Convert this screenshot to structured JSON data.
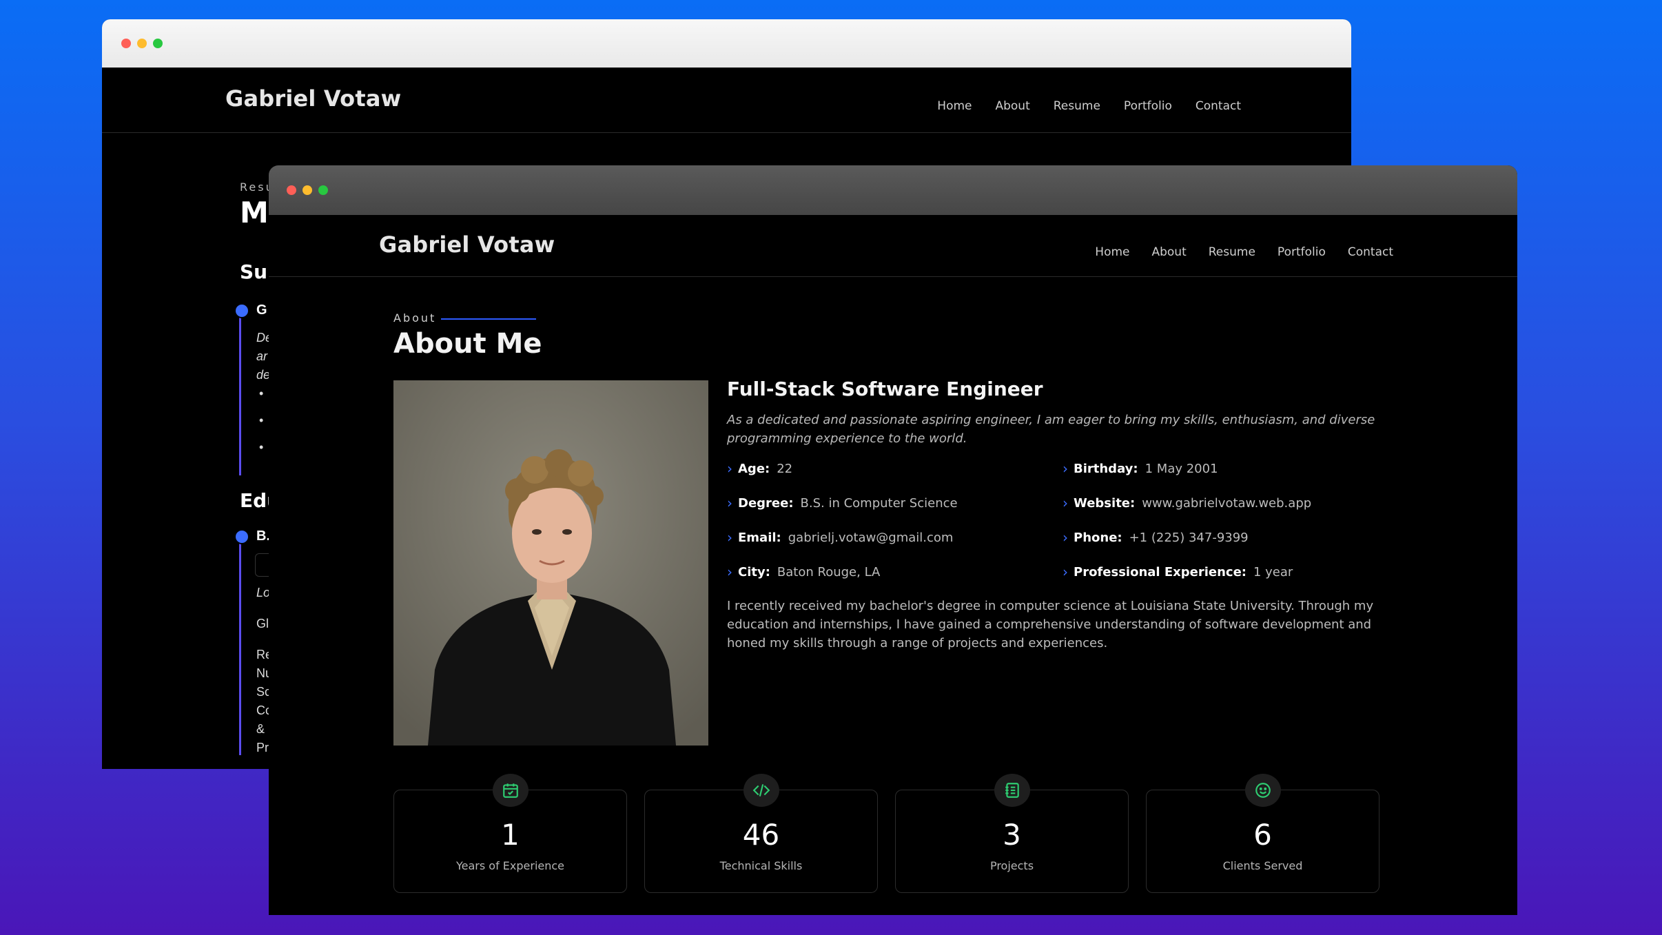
{
  "back_window": {
    "logo": "Gabriel Votaw",
    "nav": [
      "Home",
      "About",
      "Resume",
      "Portfolio",
      "Contact"
    ],
    "partial": {
      "section_label": "Resu",
      "title": "My",
      "summary_heading": "Sur",
      "summary_item": "G",
      "summary_text": [
        "De",
        "ar",
        "de"
      ],
      "education_heading": "Edu",
      "education_item": "B.",
      "edu_lines": [
        "Lo",
        "Gl",
        "Re",
        "Nu",
        "Sc",
        "Cc",
        "&",
        "Pr"
      ]
    }
  },
  "front_window": {
    "logo": "Gabriel Votaw",
    "nav": [
      "Home",
      "About",
      "Resume",
      "Portfolio",
      "Contact"
    ],
    "section_label": "About",
    "section_title": "About Me",
    "role": "Full-Stack Software Engineer",
    "tagline": "As a dedicated and passionate aspiring engineer, I am eager to bring my skills, enthusiasm, and diverse programming experience to the world.",
    "info": [
      {
        "label": "Age:",
        "value": "22"
      },
      {
        "label": "Birthday:",
        "value": "1 May 2001"
      },
      {
        "label": "Degree:",
        "value": "B.S. in Computer Science"
      },
      {
        "label": "Website:",
        "value": "www.gabrielvotaw.web.app"
      },
      {
        "label": "Email:",
        "value": "gabrielj.votaw@gmail.com"
      },
      {
        "label": "Phone:",
        "value": "+1 (225) 347-9399"
      },
      {
        "label": "City:",
        "value": "Baton Rouge, LA"
      },
      {
        "label": "Professional Experience:",
        "value": "1 year"
      }
    ],
    "bio": "I recently received my bachelor's degree in computer science at Louisiana State University. Through my education and internships, I have gained a comprehensive understanding of software development and honed my skills through a range of projects and experiences.",
    "stats": [
      {
        "number": "1",
        "label": "Years of Experience",
        "icon": "calendar-check-icon"
      },
      {
        "number": "46",
        "label": "Technical Skills",
        "icon": "code-icon"
      },
      {
        "number": "3",
        "label": "Projects",
        "icon": "journal-icon"
      },
      {
        "number": "6",
        "label": "Clients Served",
        "icon": "smiley-icon"
      }
    ]
  },
  "colors": {
    "accent_blue": "#3b6cff",
    "timeline": "#5b4df0",
    "icon_green": "#2ecc71",
    "dot_red": "#fe5f57",
    "dot_yellow": "#febc2e",
    "dot_green": "#28c840"
  }
}
